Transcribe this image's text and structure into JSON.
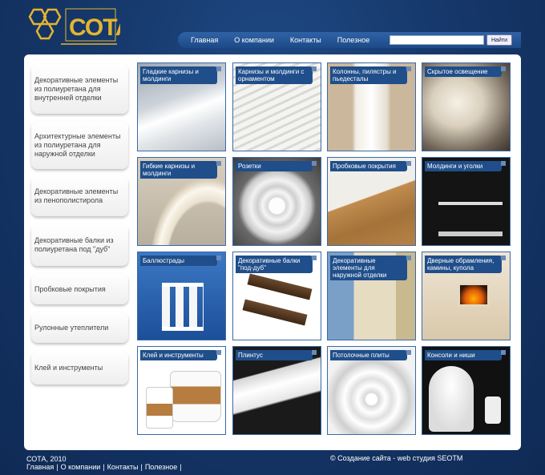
{
  "brand": {
    "logo_text": "СОТА"
  },
  "nav": {
    "items": [
      "Главная",
      "О компании",
      "Контакты",
      "Полезное"
    ]
  },
  "search": {
    "value": "",
    "button_label": "Найти"
  },
  "sidebar": {
    "items": [
      "Декоративные элементы из полиуретана для внутренней отделки",
      "Архитектурные элементы из полиуретана для наружной отделки",
      "Декоративные элементы из пенополистирола",
      "Декоративные балки из полиуретана под \"дуб\"",
      "Пробковые покрытия",
      "Рулонные утеплители",
      "Клей и инструменты"
    ]
  },
  "tiles": [
    "Гладкие карнизы и молдинги",
    "Карнизы и молдинги с орнаментом",
    "Колонны, пилястры и пьедесталы",
    "Скрытое освещение",
    "Гибкие карнизы и молдинги",
    "Розетки",
    "Пробковые покрытия",
    "Молдинги и уголки",
    "Баллюстрады",
    "Декоративные балки \"под-дуб\"",
    "Декоративные элементы для наружной отделки",
    "Дверные обрамления, камины, купола",
    "Клей и инструменты",
    "Плинтус",
    "Потолочные плиты",
    "Консоли и ниши"
  ],
  "footer": {
    "copyright": "СОТА, 2010",
    "links": [
      "Главная",
      "О компании",
      "Контакты",
      "Полезное"
    ],
    "credit": "© Создание сайта - web студия SEOTM"
  },
  "colors": {
    "background": "#16386b",
    "nav": "#1d4a88",
    "tile_label": "#1f4e8a",
    "panel": "#ffffff",
    "logo": "#e3b531"
  }
}
